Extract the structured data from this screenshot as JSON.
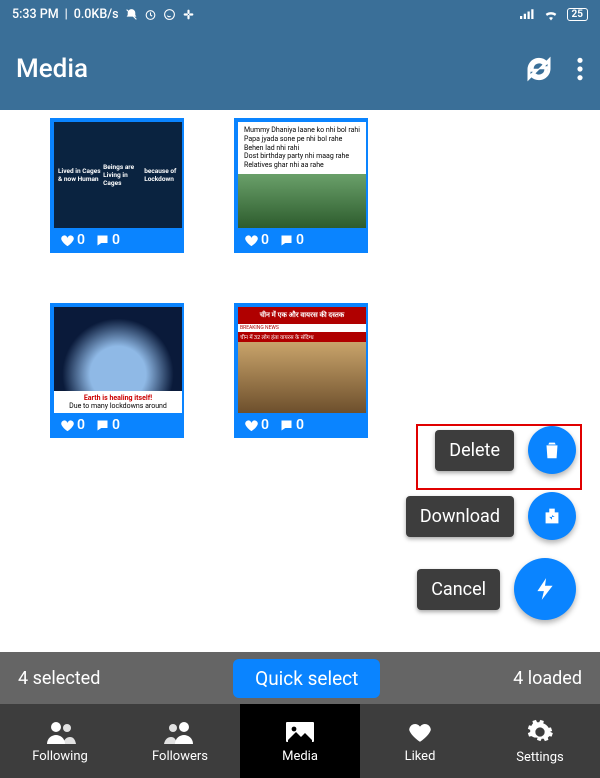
{
  "status": {
    "time": "5:33 PM",
    "net_speed": "0.0KB/s",
    "battery": "25"
  },
  "app": {
    "title": "Media"
  },
  "cards": [
    {
      "likes": "0",
      "comments": "0",
      "thumb_line1": "Lived in Cages & now Human",
      "thumb_line2": "Beings are Living in Cages",
      "thumb_line3": "because of Lockdown"
    },
    {
      "likes": "0",
      "comments": "0",
      "thumb_text": "Mummy Dhaniya laane ko nhi bol rahi\nPapa jyada sone pe nhi bol rahe\nBehen lad nhi rahi\nDost birthday party nhi maag rahe\nRelatives ghar nhi aa rahe"
    },
    {
      "likes": "0",
      "comments": "0",
      "thumb_t1": "Earth is healing itself!",
      "thumb_t2": "Due to many lockdowns around"
    },
    {
      "likes": "0",
      "comments": "0",
      "thumb_head": "चीन में एक और वायरस की दस्तक",
      "thumb_bn": "BREAKING NEWS",
      "thumb_sub": "चीन में 32 लोग हंता वायरस के संदिग्ध"
    }
  ],
  "fab": {
    "delete": "Delete",
    "download": "Download",
    "cancel": "Cancel"
  },
  "qs": {
    "selected": "4 selected",
    "button": "Quick select",
    "loaded": "4 loaded"
  },
  "tabs": {
    "following": "Following",
    "followers": "Followers",
    "media": "Media",
    "liked": "Liked",
    "settings": "Settings"
  }
}
